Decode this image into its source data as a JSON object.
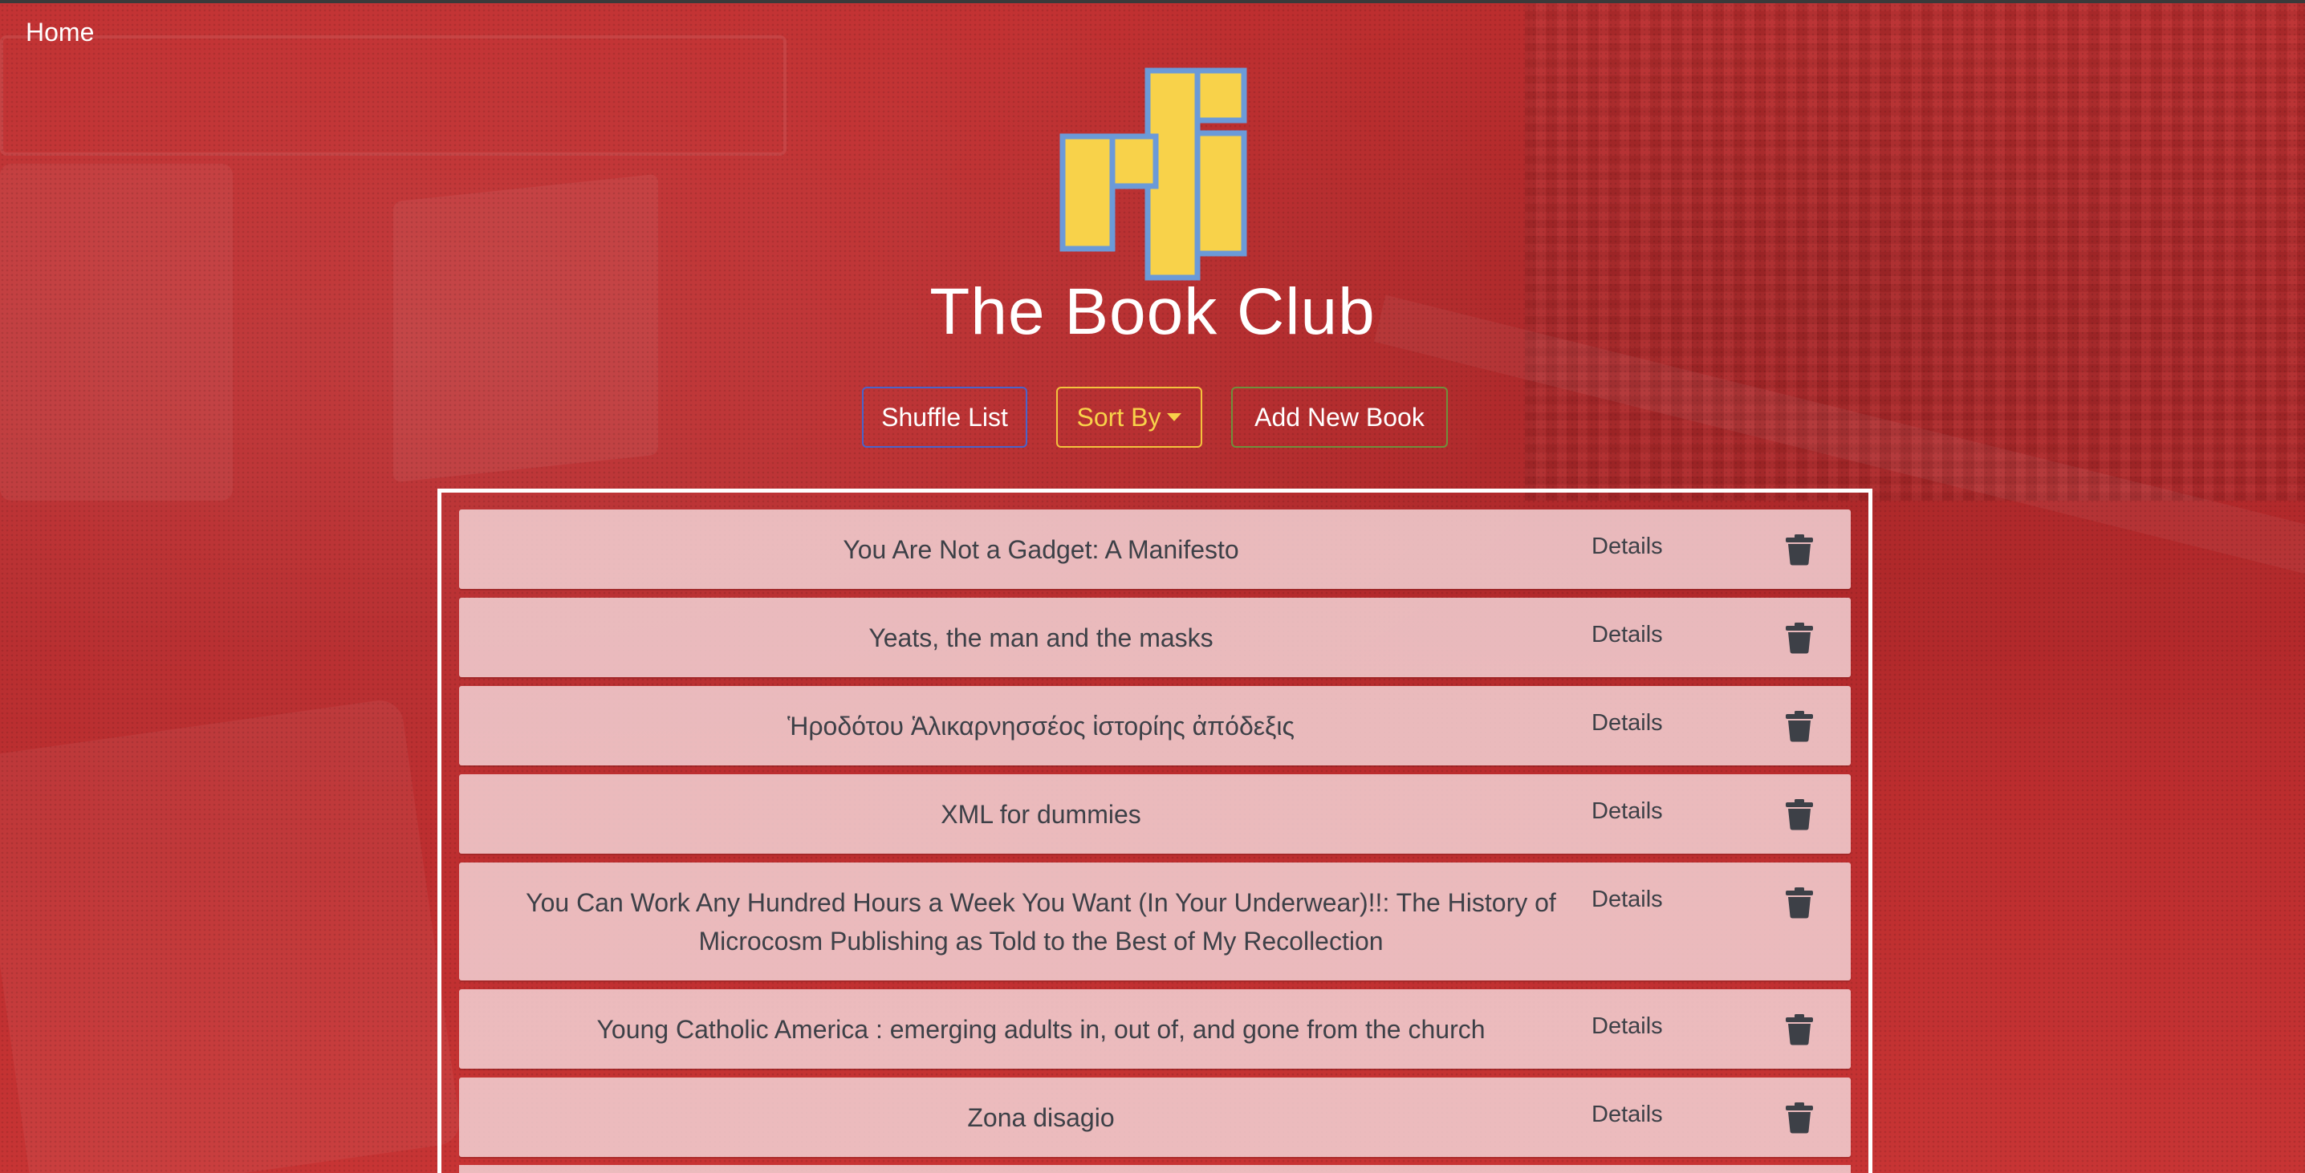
{
  "nav": {
    "home_label": "Home"
  },
  "header": {
    "site_title": "The Book Club",
    "logo_icon": "book-club-logo"
  },
  "toolbar": {
    "shuffle_label": "Shuffle List",
    "sort_label": "Sort By",
    "add_label": "Add New Book"
  },
  "colors": {
    "background": "#b7282b",
    "shuffle_border": "#4a63c9",
    "sort_accent": "#f8d24a",
    "add_border": "#6f8f3c",
    "row_background": "#f2d2d4",
    "row_text": "#3d4047",
    "logo_fill": "#f8d24a",
    "logo_stroke": "#6b9ad8"
  },
  "books": [
    {
      "title": "You Are Not a Gadget: A Manifesto",
      "details_label": "Details",
      "delete_icon": "trash-icon"
    },
    {
      "title": "Yeats, the man and the masks",
      "details_label": "Details",
      "delete_icon": "trash-icon"
    },
    {
      "title": "Ἡροδότου Ἁλικαρνησσέος ἱστορίης ἀπόδεξις",
      "details_label": "Details",
      "delete_icon": "trash-icon"
    },
    {
      "title": "XML for dummies",
      "details_label": "Details",
      "delete_icon": "trash-icon"
    },
    {
      "title": "You Can Work Any Hundred Hours a Week You Want (In Your Underwear)!!: The History of Microcosm Publishing as Told to the Best of My Recollection",
      "details_label": "Details",
      "delete_icon": "trash-icon"
    },
    {
      "title": "Young Catholic America : emerging adults in, out of, and gone from the church",
      "details_label": "Details",
      "delete_icon": "trash-icon"
    },
    {
      "title": "Zona disagio",
      "details_label": "Details",
      "delete_icon": "trash-icon"
    }
  ]
}
